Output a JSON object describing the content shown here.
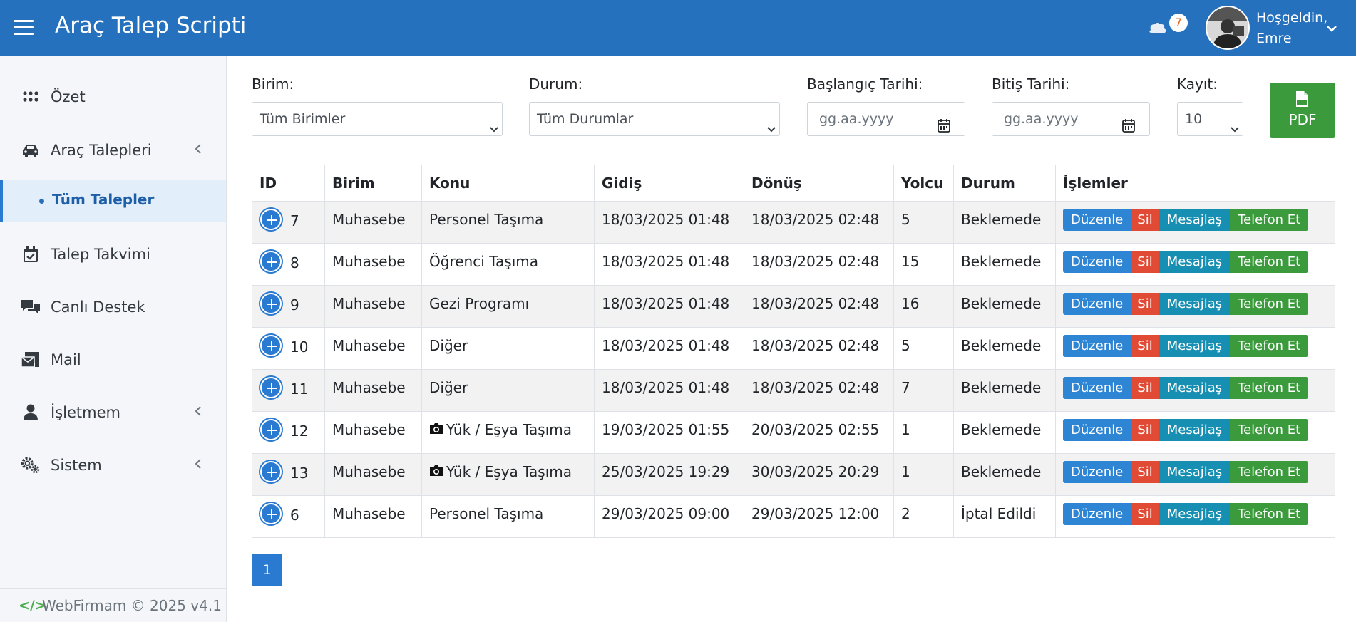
{
  "header": {
    "title": "Araç Talep Scripti",
    "notification_count": "7",
    "greeting": "Hoşgeldin,",
    "user_name": "Emre"
  },
  "sidebar": {
    "items": [
      {
        "label": "Özet",
        "icon": "grid-icon"
      },
      {
        "label": "Araç Talepleri",
        "icon": "car-icon"
      },
      {
        "label": "Tüm Talepler",
        "icon": "dot-icon"
      },
      {
        "label": "Talep Takvimi",
        "icon": "calendar-check-icon"
      },
      {
        "label": "Canlı Destek",
        "icon": "chat-icon"
      },
      {
        "label": "Mail",
        "icon": "mail-icon"
      },
      {
        "label": "İşletmem",
        "icon": "user-icon"
      },
      {
        "label": "Sistem",
        "icon": "gears-icon"
      }
    ],
    "footer": "WebFirmam © 2025 v4.1"
  },
  "filters": {
    "unit_label": "Birim:",
    "unit_value": "Tüm Birimler",
    "status_label": "Durum:",
    "status_value": "Tüm Durumlar",
    "start_label": "Başlangıç Tarihi:",
    "start_placeholder": "gg.aa.yyyy",
    "end_label": "Bitiş Tarihi:",
    "end_placeholder": "gg.aa.yyyy",
    "records_label": "Kayıt:",
    "records_value": "10",
    "pdf_label": "PDF"
  },
  "table": {
    "headers": [
      "ID",
      "Birim",
      "Konu",
      "Gidiş",
      "Dönüş",
      "Yolcu",
      "Durum",
      "İşlemler"
    ],
    "actions": {
      "edit": "Düzenle",
      "delete": "Sil",
      "message": "Mesajlaş",
      "call": "Telefon Et"
    },
    "rows": [
      {
        "id": "7",
        "unit": "Muhasebe",
        "subject": "Personel Taşıma",
        "camera": false,
        "depart": "18/03/2025 01:48",
        "return": "18/03/2025 02:48",
        "passengers": "5",
        "status": "Beklemede"
      },
      {
        "id": "8",
        "unit": "Muhasebe",
        "subject": "Öğrenci Taşıma",
        "camera": false,
        "depart": "18/03/2025 01:48",
        "return": "18/03/2025 02:48",
        "passengers": "15",
        "status": "Beklemede"
      },
      {
        "id": "9",
        "unit": "Muhasebe",
        "subject": "Gezi Programı",
        "camera": false,
        "depart": "18/03/2025 01:48",
        "return": "18/03/2025 02:48",
        "passengers": "16",
        "status": "Beklemede"
      },
      {
        "id": "10",
        "unit": "Muhasebe",
        "subject": "Diğer",
        "camera": false,
        "depart": "18/03/2025 01:48",
        "return": "18/03/2025 02:48",
        "passengers": "5",
        "status": "Beklemede"
      },
      {
        "id": "11",
        "unit": "Muhasebe",
        "subject": "Diğer",
        "camera": false,
        "depart": "18/03/2025 01:48",
        "return": "18/03/2025 02:48",
        "passengers": "7",
        "status": "Beklemede"
      },
      {
        "id": "12",
        "unit": "Muhasebe",
        "subject": "Yük / Eşya Taşıma",
        "camera": true,
        "depart": "19/03/2025 01:55",
        "return": "20/03/2025 02:55",
        "passengers": "1",
        "status": "Beklemede"
      },
      {
        "id": "13",
        "unit": "Muhasebe",
        "subject": "Yük / Eşya Taşıma",
        "camera": true,
        "depart": "25/03/2025 19:29",
        "return": "30/03/2025 20:29",
        "passengers": "1",
        "status": "Beklemede"
      },
      {
        "id": "6",
        "unit": "Muhasebe",
        "subject": "Personel Taşıma",
        "camera": false,
        "depart": "29/03/2025 09:00",
        "return": "29/03/2025 12:00",
        "passengers": "2",
        "status": "İptal Edildi"
      }
    ]
  },
  "pagination": {
    "current": "1"
  },
  "colors": {
    "primary": "#2571be",
    "success": "#3a9a3c",
    "danger": "#e14a34",
    "info": "#168fb3"
  }
}
